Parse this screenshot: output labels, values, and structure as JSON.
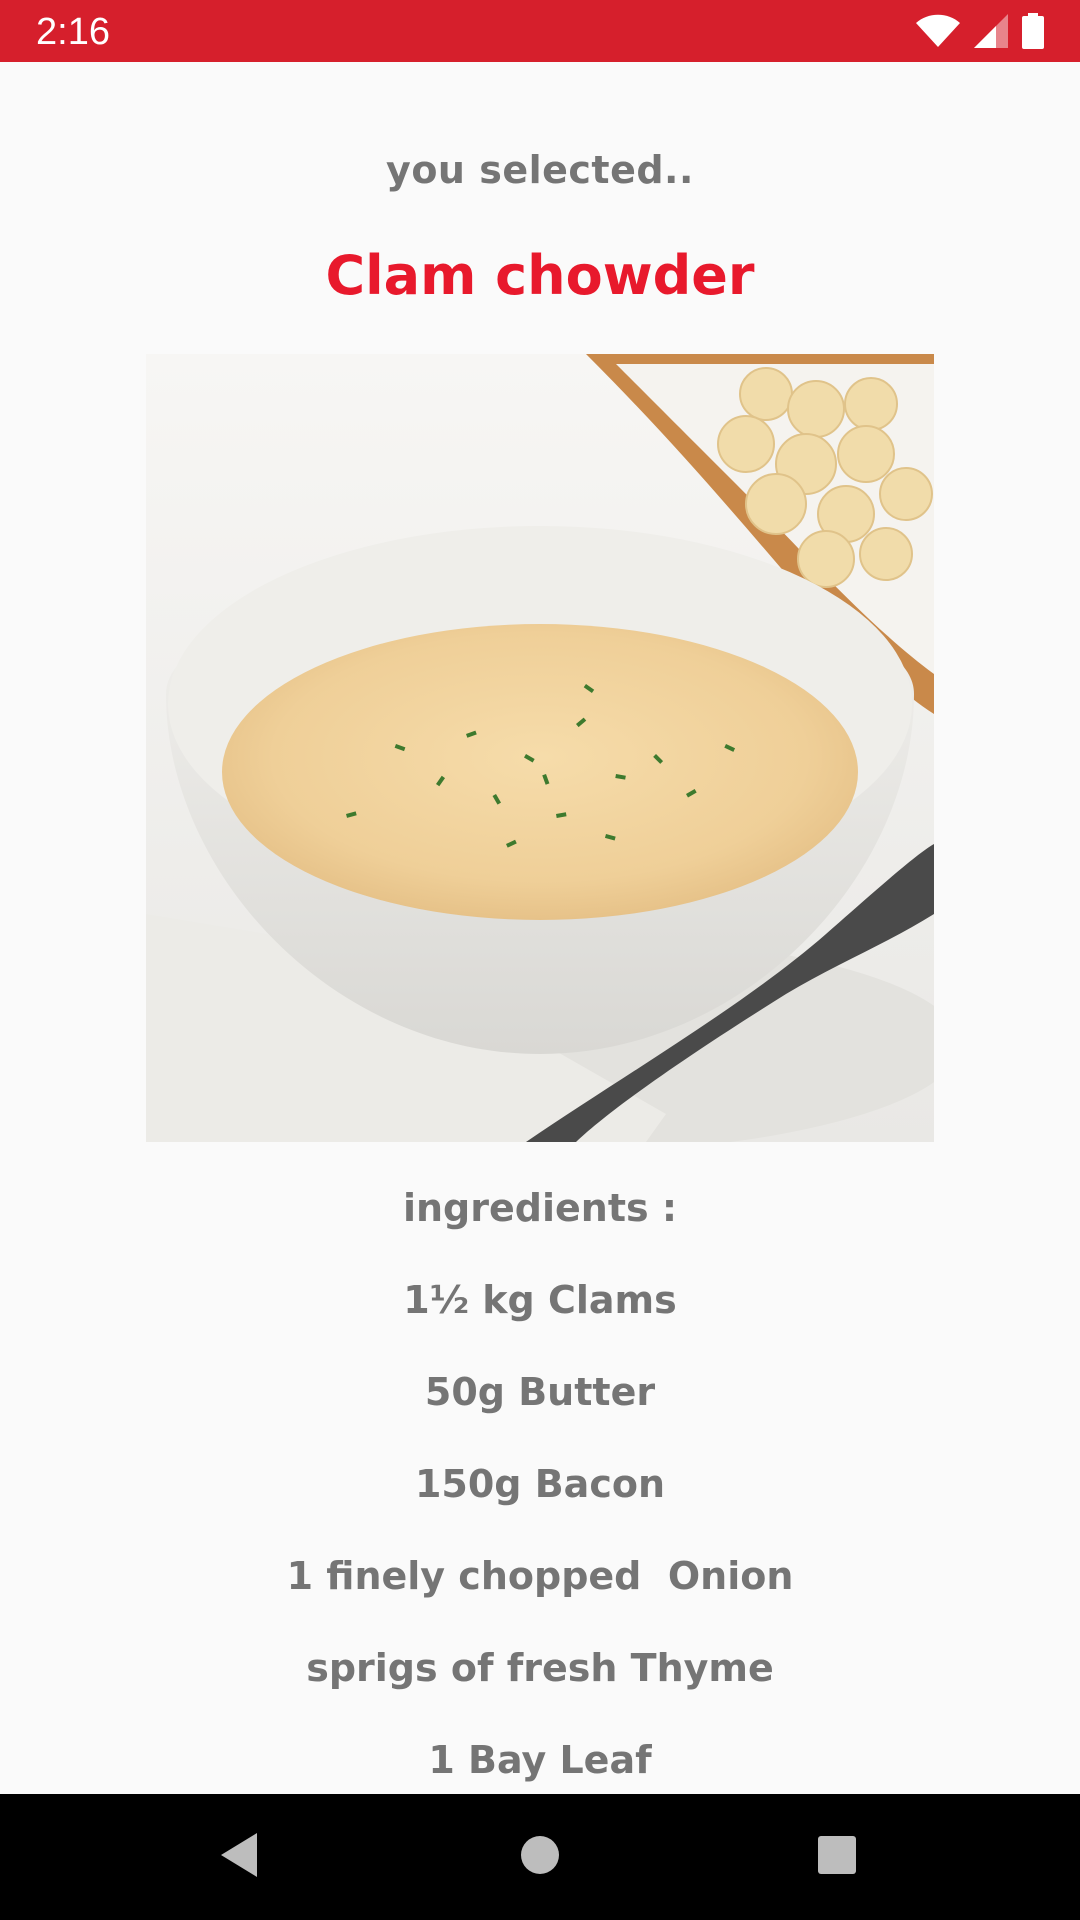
{
  "status_bar": {
    "time": "2:16",
    "background_color": "#d61f2c",
    "icons": [
      "wifi-icon",
      "cellular-signal-icon",
      "battery-icon"
    ]
  },
  "detail": {
    "selected_label": "you selected..",
    "dish_name": "Clam chowder",
    "dish_name_color": "#e8192c",
    "image_description_icon": "clam-chowder-photo",
    "ingredients_heading": "ingredients :",
    "ingredients": [
      "1½ kg Clams",
      "50g Butter",
      "150g Bacon",
      "1 finely chopped  Onion",
      "sprigs of fresh Thyme",
      "1 Bay Leaf"
    ]
  },
  "nav_bar": {
    "buttons": [
      "back-icon",
      "home-icon",
      "recents-icon"
    ]
  }
}
